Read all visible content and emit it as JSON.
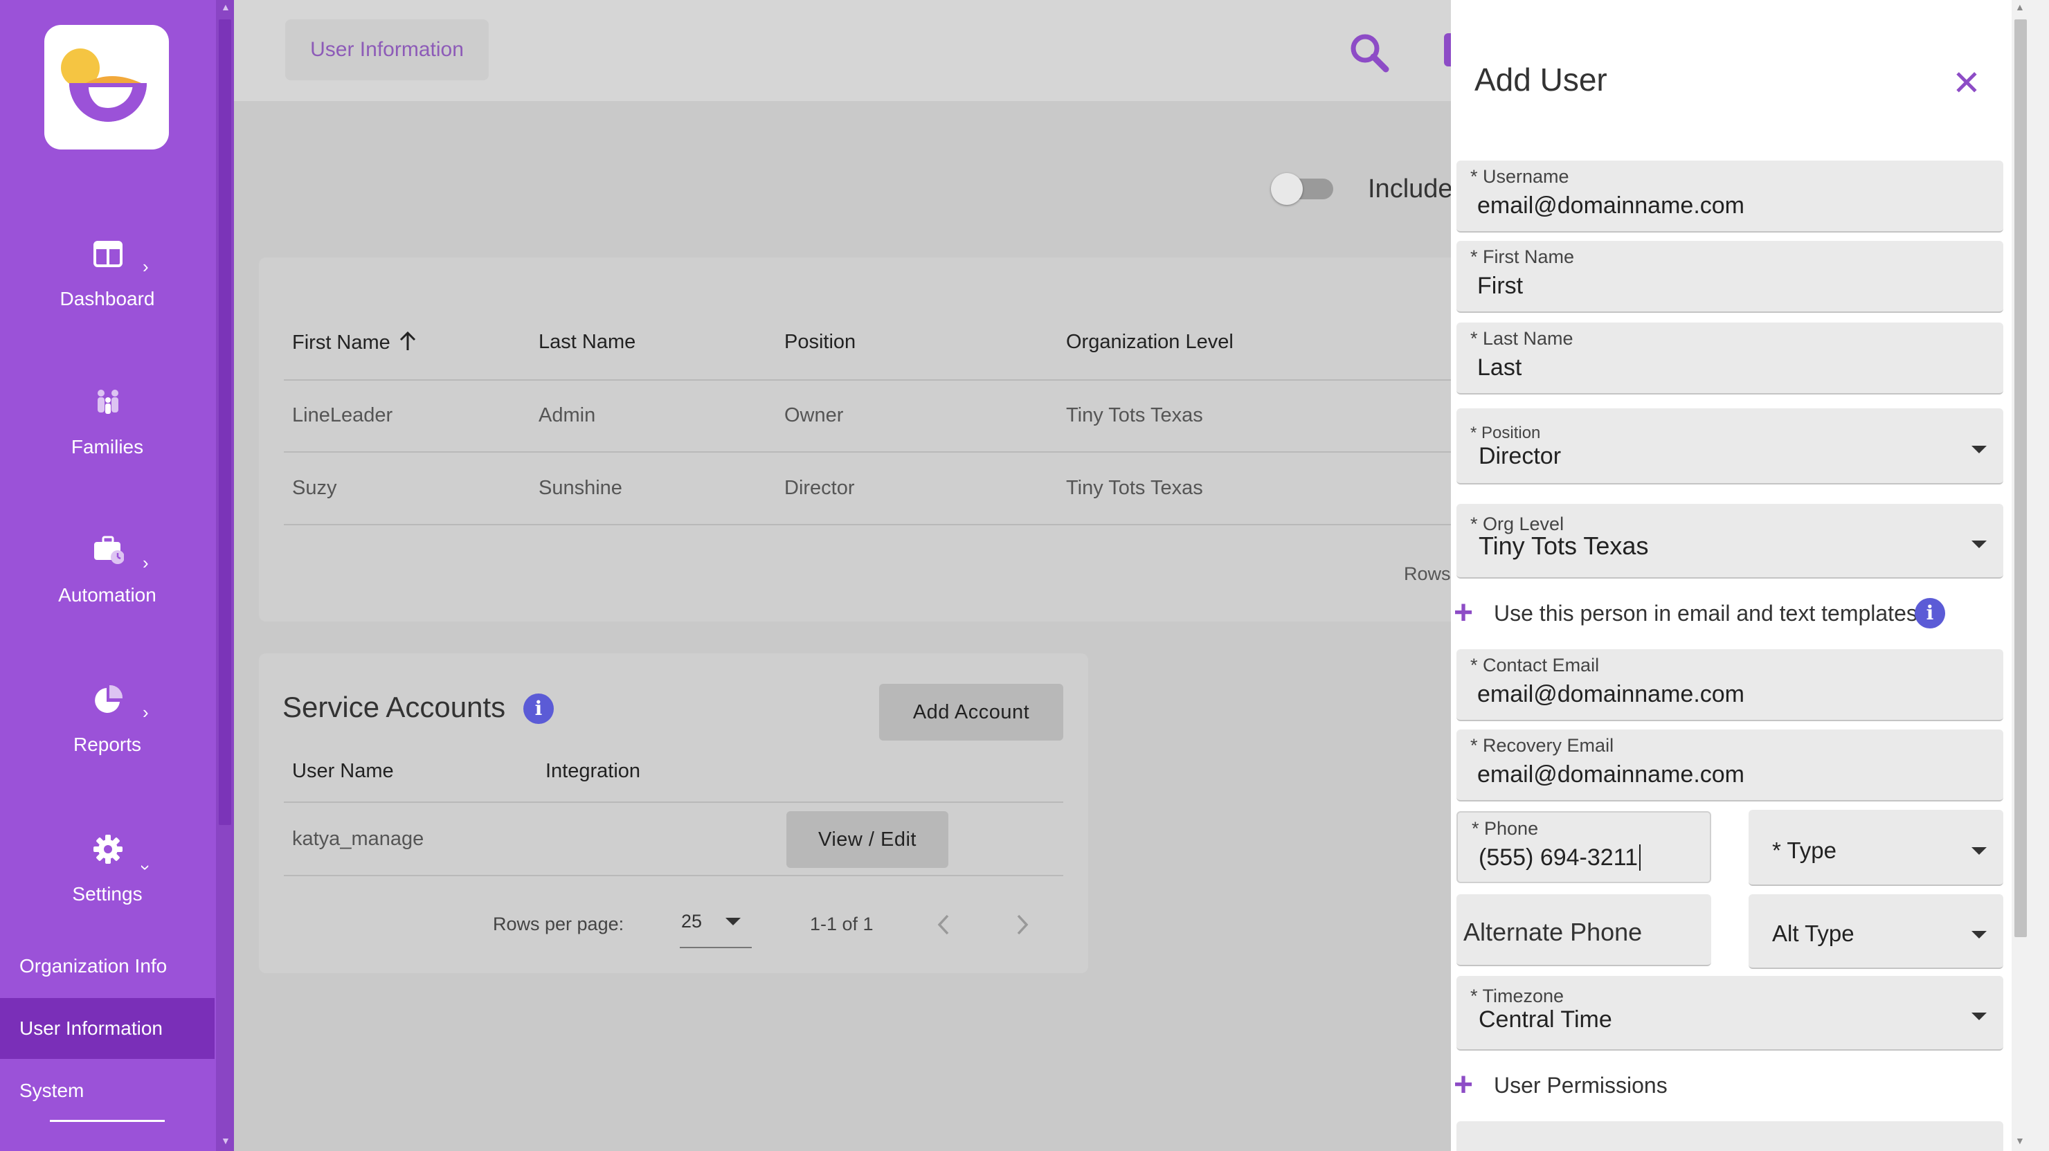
{
  "sidebar": {
    "nav": [
      {
        "label": "Dashboard",
        "icon": "dashboard-icon"
      },
      {
        "label": "Families",
        "icon": "families-icon"
      },
      {
        "label": "Automation",
        "icon": "automation-icon"
      },
      {
        "label": "Reports",
        "icon": "reports-icon"
      },
      {
        "label": "Settings",
        "icon": "settings-icon"
      }
    ],
    "sub": [
      "Organization Info",
      "User Information",
      "System"
    ]
  },
  "header": {
    "breadcrumb": "User Information"
  },
  "toolbar": {
    "include_label": "Include"
  },
  "users_table": {
    "columns": [
      "First Name",
      "Last Name",
      "Position",
      "Organization Level"
    ],
    "sort_icon": "arrow-up-icon",
    "rows": [
      [
        "LineLeader",
        "Admin",
        "Owner",
        "Tiny Tots Texas"
      ],
      [
        "Suzy",
        "Sunshine",
        "Director",
        "Tiny Tots Texas"
      ]
    ],
    "rows_label": "Rows"
  },
  "service_accounts": {
    "title": "Service Accounts",
    "add_button": "Add Account",
    "columns": [
      "User Name",
      "Integration"
    ],
    "rows": [
      {
        "user_name": "katya_manage",
        "action": "View / Edit"
      }
    ],
    "rows_per_page_label": "Rows per page:",
    "rows_per_page": "25",
    "range": "1-1 of 1"
  },
  "drawer": {
    "title": "Add User",
    "username": {
      "label": "* Username",
      "value": "email@domainname.com"
    },
    "first_name": {
      "label": "* First Name",
      "value": "First"
    },
    "last_name": {
      "label": "* Last Name",
      "value": "Last"
    },
    "position": {
      "label": "* Position",
      "value": "Director"
    },
    "org_level": {
      "label": "* Org Level",
      "value": "Tiny Tots Texas"
    },
    "template_toggle": "Use this person in email and text templates.",
    "contact_email": {
      "label": "* Contact Email",
      "value": "email@domainname.com"
    },
    "recovery_email": {
      "label": "* Recovery Email",
      "value": "email@domainname.com"
    },
    "phone": {
      "label": "* Phone",
      "value": "(555) 694-3211"
    },
    "phone_type": {
      "placeholder": "* Type"
    },
    "alt_phone": {
      "placeholder": "Alternate Phone"
    },
    "alt_type": {
      "placeholder": "Alt Type"
    },
    "timezone": {
      "label": "* Timezone",
      "value": "Central Time"
    },
    "permissions": "User Permissions"
  },
  "colors": {
    "brand": "#9b52d8",
    "accent": "#8d4cc6",
    "info": "#5b5bd6"
  }
}
